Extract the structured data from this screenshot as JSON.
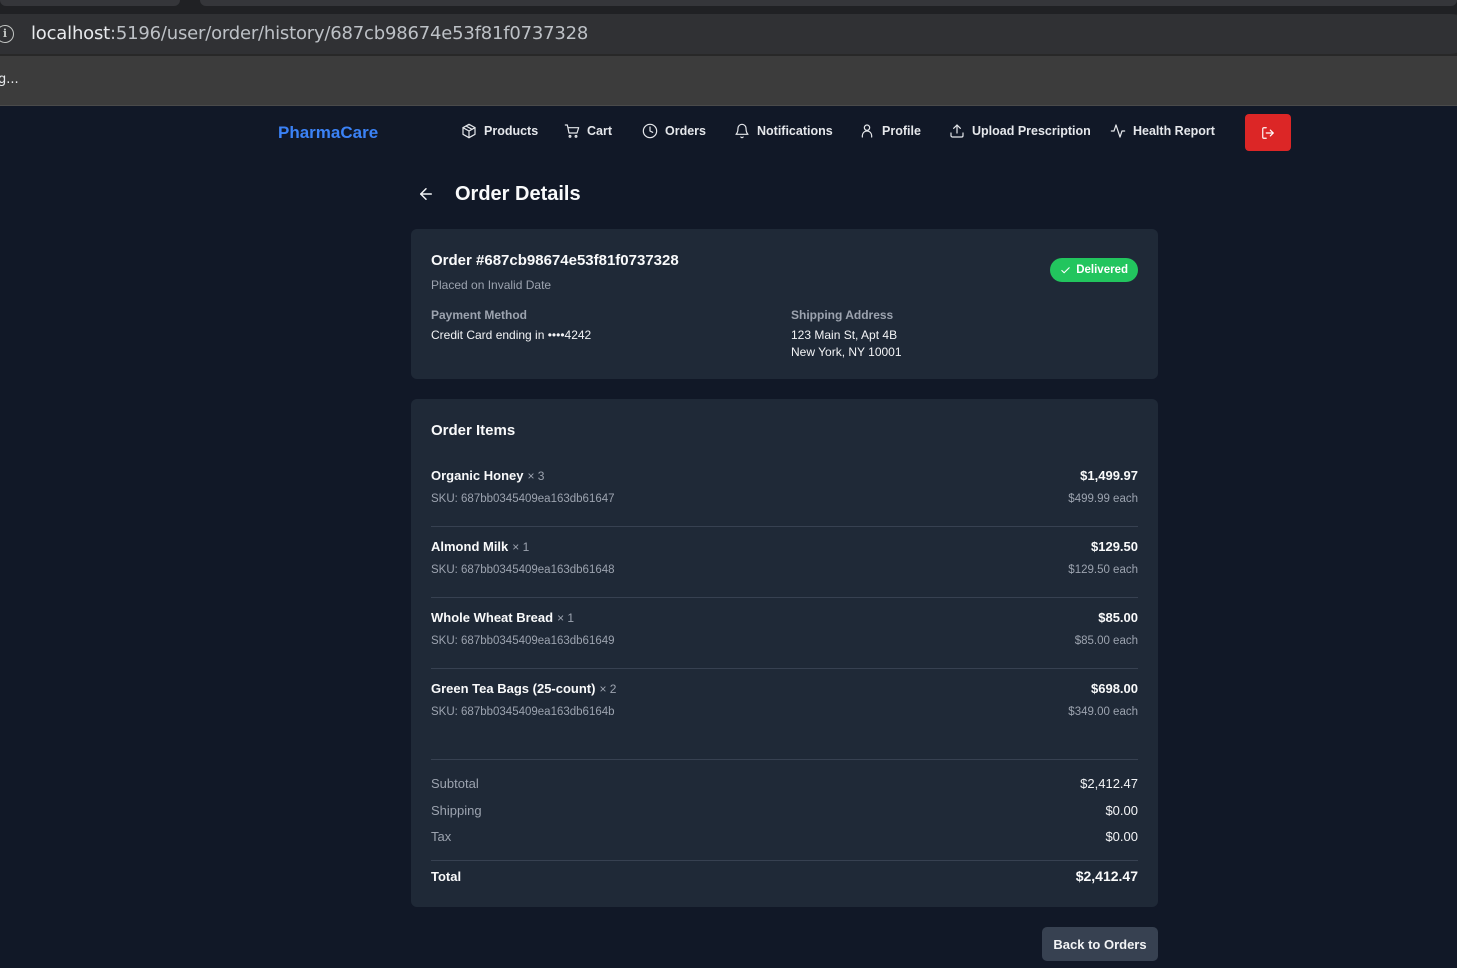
{
  "browser": {
    "url_host": "localhost",
    "url_path": ":5196/user/order/history/687cb98674e53f81f0737328",
    "status_text": "g..."
  },
  "nav": {
    "brand": "PharmaCare",
    "items": [
      {
        "label": "Products",
        "icon": "package-icon"
      },
      {
        "label": "Cart",
        "icon": "cart-icon"
      },
      {
        "label": "Orders",
        "icon": "clock-icon"
      },
      {
        "label": "Notifications",
        "icon": "bell-icon"
      },
      {
        "label": "Profile",
        "icon": "user-icon"
      },
      {
        "label": "Upload Prescription",
        "icon": "upload-icon"
      },
      {
        "label": "Health Report",
        "icon": "activity-icon"
      }
    ],
    "logout_icon": "logout-icon"
  },
  "page": {
    "title": "Order Details"
  },
  "order": {
    "id_text": "Order #687cb98674e53f81f0737328",
    "placed_text": "Placed on Invalid Date",
    "status": "Delivered",
    "payment_label": "Payment Method",
    "payment_value": "Credit Card ending in ••••4242",
    "shipping_label": "Shipping Address",
    "shipping_line1": "123 Main St, Apt 4B",
    "shipping_line2": "New York, NY 10001"
  },
  "items_section": {
    "title": "Order Items",
    "items": [
      {
        "name": "Organic Honey",
        "qty": "× 3",
        "sku": "SKU: 687bb0345409ea163db61647",
        "total": "$1,499.97",
        "each": "$499.99 each"
      },
      {
        "name": "Almond Milk",
        "qty": "× 1",
        "sku": "SKU: 687bb0345409ea163db61648",
        "total": "$129.50",
        "each": "$129.50 each"
      },
      {
        "name": "Whole Wheat Bread",
        "qty": "× 1",
        "sku": "SKU: 687bb0345409ea163db61649",
        "total": "$85.00",
        "each": "$85.00 each"
      },
      {
        "name": "Green Tea Bags (25-count)",
        "qty": "× 2",
        "sku": "SKU: 687bb0345409ea163db6164b",
        "total": "$698.00",
        "each": "$349.00 each"
      }
    ]
  },
  "totals": {
    "subtotal_label": "Subtotal",
    "subtotal_value": "$2,412.47",
    "shipping_label": "Shipping",
    "shipping_value": "$0.00",
    "tax_label": "Tax",
    "tax_value": "$0.00",
    "total_label": "Total",
    "total_value": "$2,412.47"
  },
  "actions": {
    "back_to_orders": "Back to Orders"
  },
  "colors": {
    "background": "#111827",
    "card": "#1f2937",
    "brand": "#3b82f6",
    "status_delivered": "#22c55e",
    "logout": "#dc2626"
  }
}
